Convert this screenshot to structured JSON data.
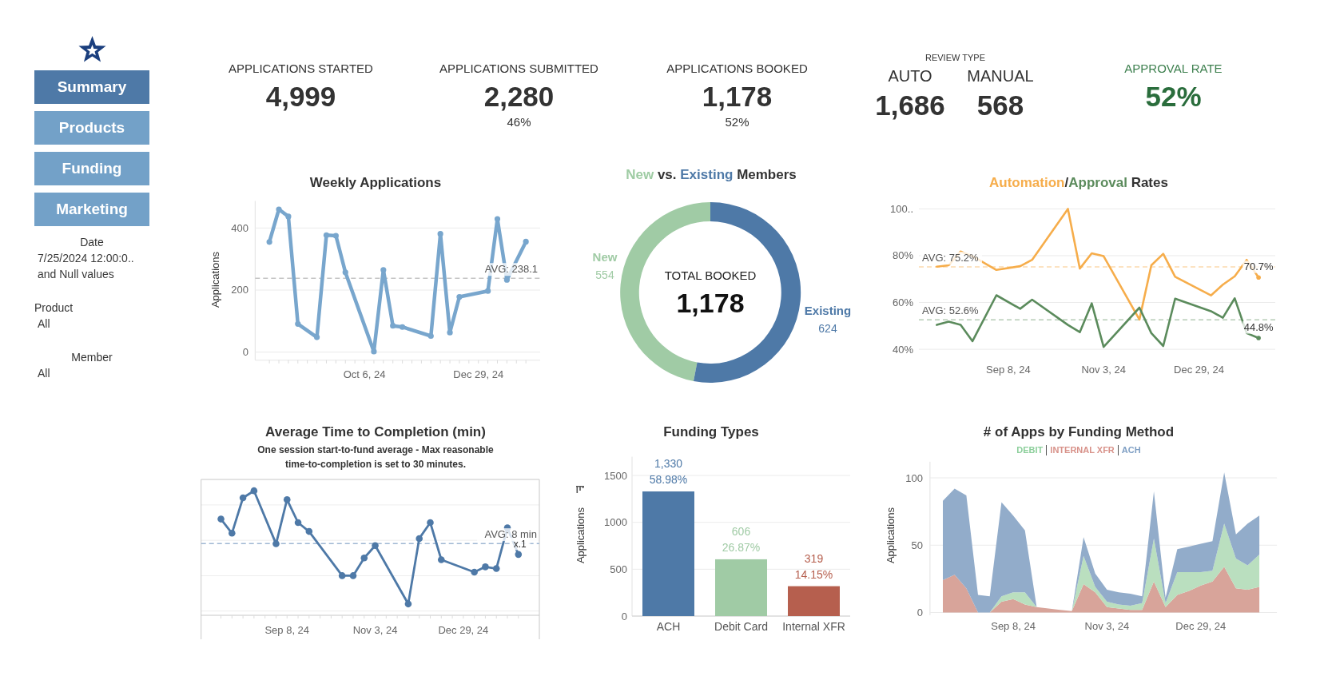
{
  "sidebar": {
    "nav": [
      {
        "label": "Summary",
        "selected": true
      },
      {
        "label": "Products",
        "selected": false
      },
      {
        "label": "Funding",
        "selected": false
      },
      {
        "label": "Marketing",
        "selected": false
      }
    ],
    "filters": [
      {
        "label": "Date",
        "values": [
          "7/25/2024 12:00:0..",
          "and Null values"
        ]
      },
      {
        "label": "Product",
        "values": [
          "All"
        ]
      },
      {
        "label": "Member",
        "values": [
          "All"
        ]
      }
    ]
  },
  "kpis": [
    {
      "kind": "metric",
      "label": "APPLICATIONS STARTED",
      "value": "4,999"
    },
    {
      "kind": "metric",
      "label": "APPLICATIONS SUBMITTED",
      "value": "2,280",
      "sub": "46%"
    },
    {
      "kind": "metric",
      "label": "APPLICATIONS BOOKED",
      "value": "1,178",
      "sub": "52%"
    },
    {
      "kind": "split",
      "label": "REVIEW TYPE",
      "items": [
        {
          "label": "AUTO",
          "value": "1,686"
        },
        {
          "label": "MANUAL",
          "value": "568"
        }
      ]
    },
    {
      "kind": "rate",
      "label": "APPROVAL RATE",
      "value": "52%"
    }
  ],
  "charts": [
    {
      "kind": "line",
      "title": "Weekly Applications",
      "chart_data": {
        "type": "line",
        "ylabel": "Applications",
        "categories": [
          null,
          null,
          null,
          null,
          null,
          null,
          null,
          null,
          null,
          null,
          "Oct 6, 24",
          null,
          null,
          null,
          null,
          null,
          null,
          null,
          null,
          null,
          null,
          null,
          "Dec 29, 24",
          null,
          null,
          null,
          null,
          null
        ],
        "series": [
          {
            "color": "#78a6cd",
            "marker": "circle",
            "values": [
              355,
              460,
              437,
              91,
              null,
              48,
              377,
              375,
              257,
              null,
              null,
              2,
              265,
              85,
              81,
              null,
              null,
              52,
              381,
              63,
              178,
              null,
              null,
              197,
              429,
              233,
              null,
              356
            ]
          }
        ],
        "ylim": [
          -26,
          487
        ],
        "yticks": [
          0,
          200,
          400
        ],
        "grid": true,
        "ref_lines": [
          {
            "axis": "y",
            "value": 238.1,
            "label": "AVG: 238.1"
          }
        ]
      }
    },
    {
      "kind": "donut",
      "title_parts": [
        {
          "text": "New",
          "color": "#9fcca4"
        },
        {
          "text": " vs. "
        },
        {
          "text": "Existing",
          "color": "#4e79a7"
        },
        {
          "text": " Members"
        }
      ],
      "chart_data": {
        "type": "donut",
        "categories": [
          "New",
          "Existing"
        ],
        "values": [
          554,
          624
        ],
        "colors": [
          "#a0cba5",
          "#4e79a7"
        ],
        "value_labels": [
          "554",
          "624"
        ]
      },
      "center_label": "TOTAL BOOKED",
      "center_value": "1,178"
    },
    {
      "kind": "multi_line",
      "title_parts": [
        {
          "text": "Automation",
          "color": "#f6ad4b"
        },
        {
          "text": "/"
        },
        {
          "text": "Approval",
          "color": "#5b8b5c"
        },
        {
          "text": " Rates"
        }
      ],
      "chart_data": {
        "type": "line",
        "categories": [
          null,
          null,
          null,
          null,
          null,
          null,
          "Sep 8, 24",
          null,
          null,
          null,
          null,
          null,
          null,
          null,
          "Nov 3, 24",
          null,
          null,
          null,
          null,
          null,
          null,
          null,
          "Dec 29, 24",
          null,
          null,
          null,
          null,
          null
        ],
        "series": [
          {
            "color": "#f6ad4b",
            "values": [
              75.3,
              75.9,
              81.8,
              79.8,
              null,
              73.9,
              null,
              75.5,
              78.2,
              null,
              null,
              100,
              74.5,
              81,
              79.8,
              null,
              null,
              52.7,
              75.9,
              80.8,
              71,
              null,
              null,
              63,
              67.6,
              71.2,
              78.2,
              70.7
            ]
          },
          {
            "color": "#5b8b5c",
            "values": [
              50.4,
              51.8,
              50.4,
              43.5,
              null,
              63.1,
              null,
              57.3,
              61.2,
              null,
              null,
              50.4,
              47.3,
              59.6,
              41,
              null,
              null,
              57.8,
              46.9,
              41.4,
              61.6,
              null,
              null,
              56.3,
              53.5,
              61.8,
              46.9,
              44.8
            ]
          }
        ],
        "ylim": [
          40,
          100
        ],
        "yticks": [
          {
            "value": 40,
            "label": "40%"
          },
          {
            "value": 60,
            "label": "60%"
          },
          {
            "value": 80,
            "label": "80%"
          },
          {
            "value": 100,
            "label": "100.."
          }
        ],
        "grid": true,
        "ref_lines": [
          {
            "axis": "y",
            "value": 75.2,
            "label": "AVG: 75.2%",
            "color": "#f6ad4b"
          },
          {
            "axis": "y",
            "value": 52.6,
            "label": "AVG: 52.6%",
            "color": "#5b8b5c"
          }
        ],
        "annotations": [
          {
            "y": 70.7,
            "text": "70.7%"
          },
          {
            "y": 44.8,
            "text": "44.8%"
          }
        ]
      }
    },
    {
      "kind": "framed_line",
      "title": "Average Time to Completion (min)",
      "subtitle": "One session start-to-fund average - Max reasonable\ntime-to-completion is set to 30 minutes.",
      "x_labels": [
        "Sep 8, 24",
        "Nov 3, 24",
        "Dec 29, 24"
      ],
      "average_label": "AVG: 8 min",
      "point_label": "x.1"
    },
    {
      "kind": "bar",
      "title": "Funding Types",
      "chart_data": {
        "type": "bar",
        "ylabel": "Applications",
        "categories": [
          "ACH",
          "Debit Card",
          "Internal XFR"
        ],
        "values": [
          1330,
          606,
          319
        ],
        "colors": [
          "#4e79a7",
          "#a0cba5",
          "#b65f4e"
        ],
        "ylim": [
          0,
          1700
        ],
        "yticks": [
          0,
          500,
          1000,
          1500
        ],
        "grid": true,
        "value_labels": [
          [
            "1,330",
            "58.98%"
          ],
          [
            "606",
            "26.87%"
          ],
          [
            "319",
            "14.15%"
          ]
        ]
      }
    },
    {
      "kind": "stacked_area",
      "title": "# of Apps by Funding Method",
      "legend": [
        {
          "label": "DEBIT",
          "color": "#8ccf9b"
        },
        {
          "label": "INTERNAL XFR",
          "color": "#d8928a"
        },
        {
          "label": "ACH",
          "color": "#7f9fc4"
        }
      ],
      "chart_data": {
        "type": "area",
        "stacked": true,
        "ylabel": "Applications",
        "categories": [
          null,
          null,
          null,
          null,
          null,
          null,
          "Sep 8, 24",
          null,
          null,
          null,
          null,
          null,
          null,
          null,
          "Nov 3, 24",
          null,
          null,
          null,
          null,
          null,
          null,
          null,
          "Dec 29, 24",
          null,
          null,
          null,
          null,
          null
        ],
        "series": [
          {
            "color": "#d8a49a",
            "values": [
              24,
              28,
              18,
              0,
              0,
              8,
              10,
              6,
              4,
              3,
              2,
              1,
              21,
              15,
              4,
              3,
              2,
              2,
              23,
              4,
              13,
              16,
              20,
              23,
              34,
              18,
              17,
              19
            ]
          },
          {
            "color": "#badfbf",
            "values": [
              0,
              0,
              0,
              0,
              0,
              4,
              5,
              9,
              0,
              0,
              0,
              0,
              21,
              4,
              4,
              3,
              3,
              5,
              32,
              3,
              17,
              14,
              10,
              8,
              32,
              22,
              18,
              24
            ]
          },
          {
            "color": "#92acca",
            "values": [
              59,
              64,
              69,
              13,
              12,
              70,
              57,
              46,
              0,
              0,
              0,
              0,
              14,
              10,
              9,
              9,
              9,
              5,
              35,
              4,
              17,
              19,
              21,
              22,
              38,
              18,
              31,
              29
            ]
          }
        ],
        "ylim": [
          -2,
          112
        ],
        "yticks": [
          0,
          50,
          100
        ],
        "grid": true
      }
    }
  ]
}
